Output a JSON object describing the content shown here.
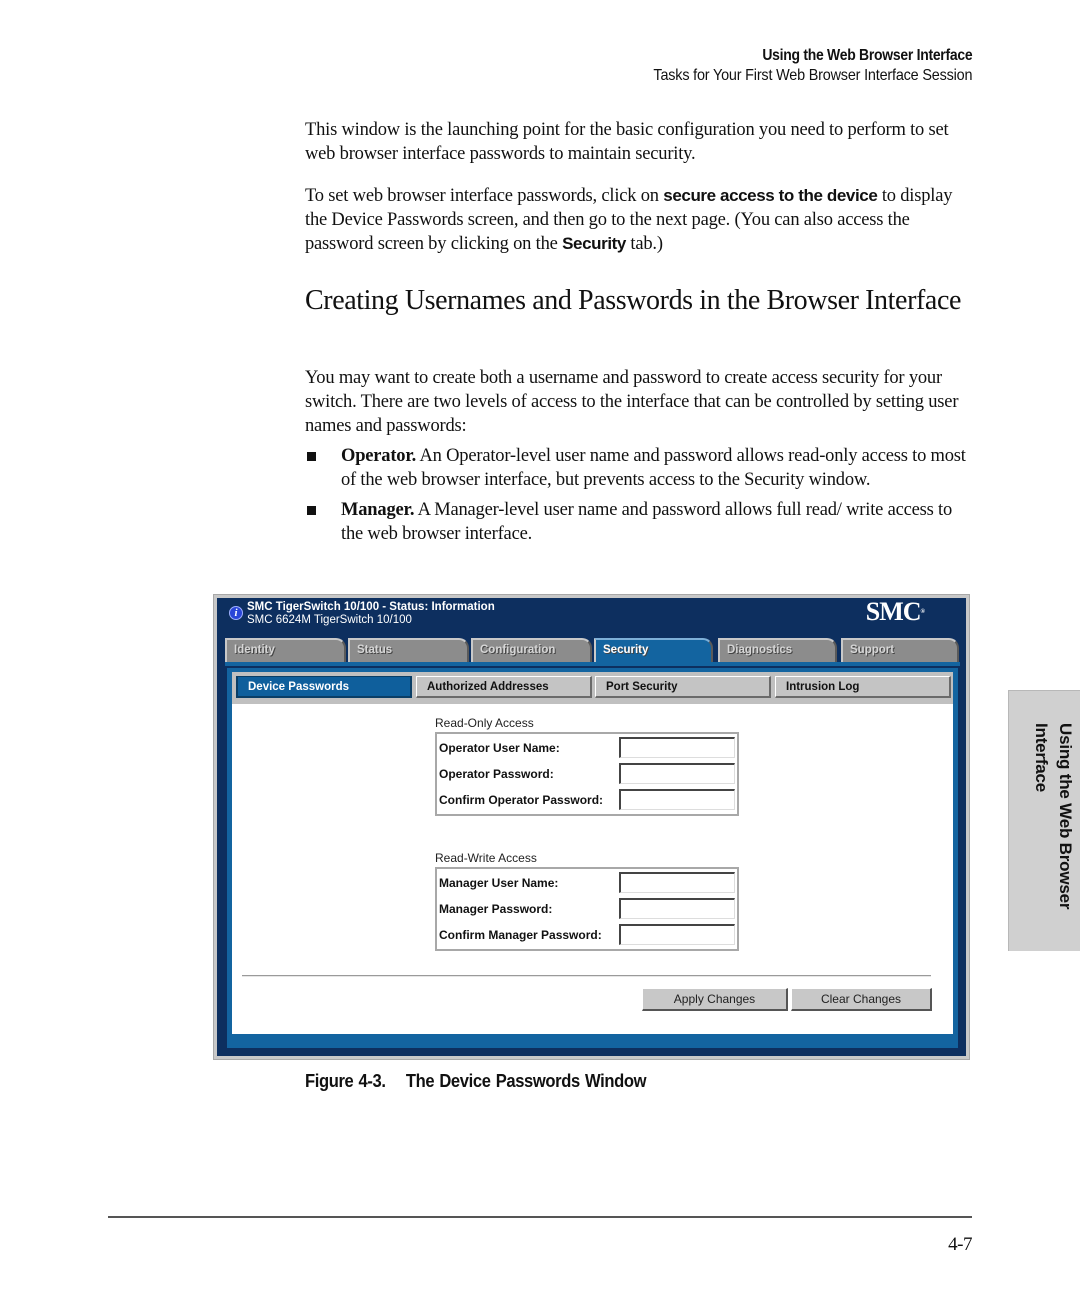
{
  "running_head": {
    "chapter": "Using the Web Browser Interface",
    "section": "Tasks for Your First Web Browser Interface Session"
  },
  "paragraphs": {
    "p1": "This window is the launching point for the basic configuration you need to perform to set web browser interface passwords to maintain security.",
    "p2_before": "To set web browser interface passwords, click on ",
    "p2_bold1": "secure access to the device",
    "p2_middle": " to display the Device Passwords screen, and then go to the next page. (You can also access the password screen by clicking on the ",
    "p2_bold2": "Security",
    "p2_after": " tab.)",
    "p3": "You may want to create both a username and password to create access security for your switch. There are two levels of access to the interface that can be controlled by setting user names and passwords:"
  },
  "section_heading": "Creating Usernames and Passwords in the Browser Interface",
  "bullets": [
    {
      "term": "Operator.",
      "text": " An Operator-level user name and password allows read-only access to most of the web browser interface, but prevents access to the Security window."
    },
    {
      "term": "Manager.",
      "text": " A Manager-level user name and password allows full read/ write access to the web browser interface."
    }
  ],
  "screenshot": {
    "header_title": "SMC TigerSwitch 10/100 - Status: Information",
    "header_subtitle": "SMC 6624M TigerSwitch 10/100",
    "logo": "SMC",
    "info_icon": "i",
    "tabs": [
      {
        "label": "Identity",
        "active": false
      },
      {
        "label": "Status",
        "active": false
      },
      {
        "label": "Configuration",
        "active": false
      },
      {
        "label": "Security",
        "active": true
      },
      {
        "label": "Diagnostics",
        "active": false
      },
      {
        "label": "Support",
        "active": false
      }
    ],
    "subtabs": [
      {
        "label": "Device Passwords",
        "active": true
      },
      {
        "label": "Authorized Addresses",
        "active": false
      },
      {
        "label": "Port Security",
        "active": false
      },
      {
        "label": "Intrusion Log",
        "active": false
      }
    ],
    "read_only": {
      "label": "Read-Only Access",
      "fields": [
        {
          "label": "Operator User Name:",
          "value": ""
        },
        {
          "label": "Operator Password:",
          "value": ""
        },
        {
          "label": "Confirm Operator Password:",
          "value": ""
        }
      ]
    },
    "read_write": {
      "label": "Read-Write Access",
      "fields": [
        {
          "label": "Manager User Name:",
          "value": ""
        },
        {
          "label": "Manager Password:",
          "value": ""
        },
        {
          "label": "Confirm Manager Password:",
          "value": ""
        }
      ]
    },
    "buttons": {
      "apply": "Apply Changes",
      "clear": "Clear Changes"
    }
  },
  "caption": {
    "number": "Figure 4-3.",
    "title": "The Device Passwords Window"
  },
  "side_tab": {
    "line1": "Using the Web Browser",
    "line2": "Interface"
  },
  "page_number": "4-7"
}
